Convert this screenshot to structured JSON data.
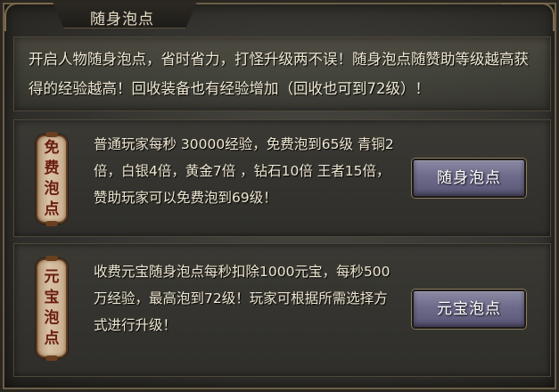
{
  "window": {
    "title": "随身泡点"
  },
  "intro": {
    "text": "开启人物随身泡点，省时省力，打怪升级两不误！随身泡点随赞助等级越高获得的经验越高！回收装备也有经验增加（回收也可到72级）！"
  },
  "free_section": {
    "label_chars": [
      "免",
      "费",
      "泡",
      "点"
    ],
    "description": "普通玩家每秒 30000经验，免费泡到65级 青铜2倍，白银4倍，黄金7倍 ，钻石10倍 王者15倍，赞助玩家可以免费泡到69级！",
    "button_label": "随身泡点"
  },
  "ingot_section": {
    "label_chars": [
      "元",
      "宝",
      "泡",
      "点"
    ],
    "description": "收费元宝随身泡点每秒扣除1000元宝，每秒500万经验，最高泡到72级！玩家可根据所需选择方式进行升级！",
    "button_label": "元宝泡点"
  },
  "colors": {
    "panel_bg": "#34332f",
    "text": "#efe7d2",
    "label_bg": "#d8c2a5",
    "label_text": "#6a1d10",
    "button_bg": "#6d6a8a"
  }
}
